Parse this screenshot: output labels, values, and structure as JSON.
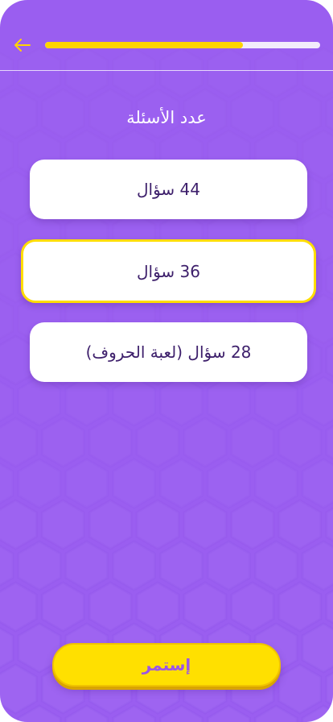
{
  "header": {
    "back_icon": "arrow-left-icon",
    "progress_fraction": 0.72
  },
  "screen": {
    "title": "عدد الأسئلة"
  },
  "options": [
    {
      "label": "44 سؤال"
    },
    {
      "label": "36 سؤال",
      "selected": true
    },
    {
      "label": "28 سؤال (لعبة الحروف)"
    }
  ],
  "actions": {
    "continue_label": "إستمر"
  },
  "colors": {
    "background": "#9a5ef0",
    "accent": "#ffd400",
    "option_text": "#3d1f6b",
    "selected_border": "#ffdd00"
  }
}
